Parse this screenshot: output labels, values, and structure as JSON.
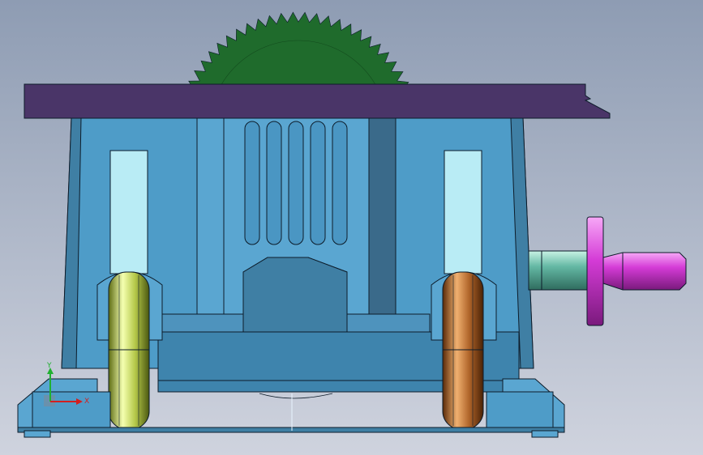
{
  "viewport": {
    "background_top": "#8e9cb3",
    "background_bottom": "#cfd3de"
  },
  "model": {
    "blade_color": "#1f6b2c",
    "table_top_color": "#4a3568",
    "housing_color": "#4e9cc8",
    "housing_dark": "#3f7fa4",
    "housing_shadow": "#3a6a8a",
    "slot_highlight": "#b9ecf5",
    "left_wheel_color": "#b6c94a",
    "right_wheel_color": "#b0652a",
    "handle_color": "#d43bd6",
    "shaft_color": "#64b8a4",
    "edge_color": "#0d1c2a"
  },
  "triad": {
    "x_label": "X",
    "y_label": "Y",
    "x_color": "#d22020",
    "y_color": "#20b030"
  }
}
